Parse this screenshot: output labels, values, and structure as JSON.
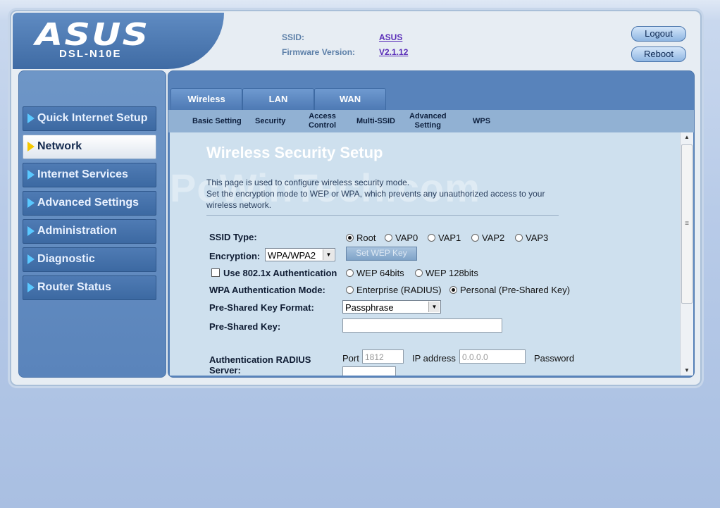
{
  "header": {
    "brand": "ASUS",
    "model": "DSL-N10E",
    "ssid_label": "SSID:",
    "ssid_value": "ASUS",
    "fw_label": "Firmware Version:",
    "fw_value": "V2.1.12",
    "logout": "Logout",
    "reboot": "Reboot"
  },
  "sidebar": {
    "items": [
      {
        "label": "Quick Internet Setup"
      },
      {
        "label": "Network"
      },
      {
        "label": "Internet Services"
      },
      {
        "label": "Advanced Settings"
      },
      {
        "label": "Administration"
      },
      {
        "label": "Diagnostic"
      },
      {
        "label": "Router Status"
      }
    ]
  },
  "tabs": [
    {
      "label": "Wireless"
    },
    {
      "label": "LAN"
    },
    {
      "label": "WAN"
    }
  ],
  "subtabs": {
    "basic": "Basic Setting",
    "security": "Security",
    "access_1": "Access",
    "access_2": "Control",
    "multi": "Multi-SSID",
    "adv_1": "Advanced",
    "adv_2": "Setting",
    "wps": "WPS"
  },
  "content": {
    "watermark": "PcWinTech.com",
    "title": "Wireless Security Setup",
    "desc_1": "This page is used to configure wireless security mode.",
    "desc_2": "Set the encryption mode to WEP or WPA, which prevents any unauthorized access to your",
    "desc_3": "wireless network.",
    "ssid_type_label": "SSID Type:",
    "ssid_options": [
      "Root",
      "VAP0",
      "VAP1",
      "VAP2",
      "VAP3"
    ],
    "encryption_label": "Encryption:",
    "encryption_value": "WPA/WPA2",
    "set_wep_key": "Set WEP Key",
    "use_8021x": "Use 802.1x Authentication",
    "wep64": "WEP 64bits",
    "wep128": "WEP 128bits",
    "wpa_mode_label": "WPA Authentication Mode:",
    "wpa_enterprise": "Enterprise (RADIUS)",
    "wpa_personal": "Personal (Pre-Shared Key)",
    "psk_format_label": "Pre-Shared Key Format:",
    "psk_format_value": "Passphrase",
    "psk_label": "Pre-Shared Key:",
    "radius_label_1": "Authentication RADIUS",
    "radius_label_2": "Server:",
    "port_label": "Port",
    "port_value": "1812",
    "ip_label": "IP address",
    "ip_value": "0.0.0.0",
    "password_label": "Password"
  }
}
